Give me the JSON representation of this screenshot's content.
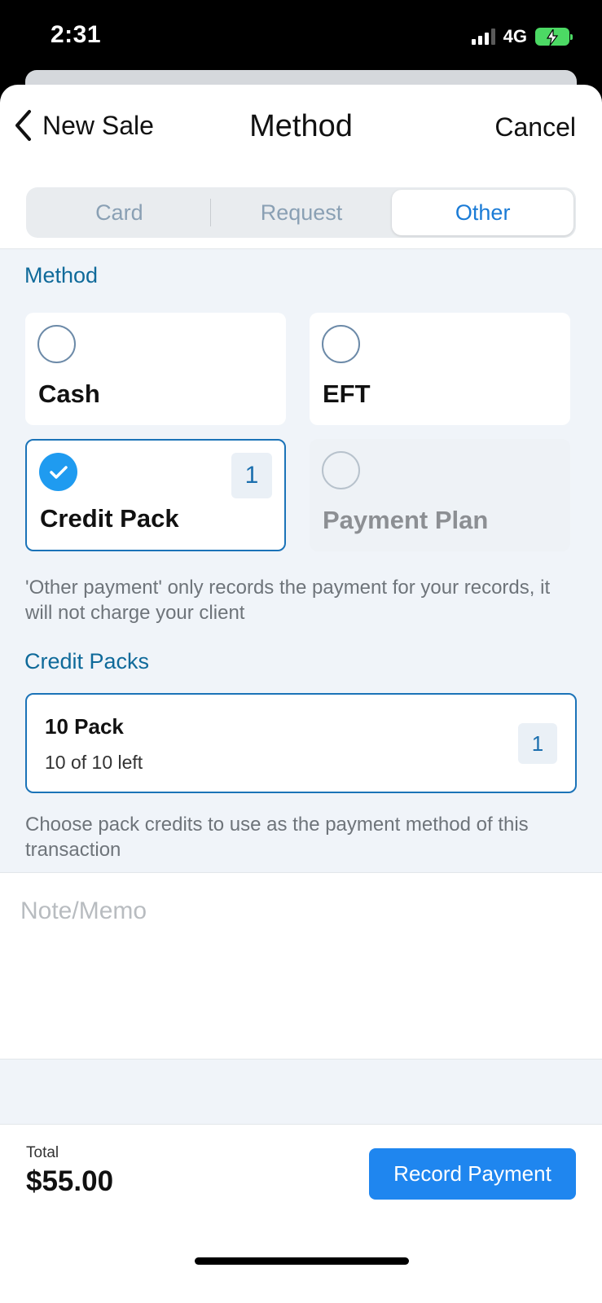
{
  "status_bar": {
    "time": "2:31",
    "network": "4G"
  },
  "nav": {
    "back_label": "New Sale",
    "title": "Method",
    "cancel_label": "Cancel"
  },
  "tabs": [
    {
      "label": "Card",
      "active": false
    },
    {
      "label": "Request",
      "active": false
    },
    {
      "label": "Other",
      "active": true
    }
  ],
  "method_section": {
    "label": "Method",
    "options": [
      {
        "name": "Cash",
        "selected": false,
        "disabled": false
      },
      {
        "name": "EFT",
        "selected": false,
        "disabled": false
      },
      {
        "name": "Credit Pack",
        "selected": true,
        "disabled": false,
        "count": "1"
      },
      {
        "name": "Payment Plan",
        "selected": false,
        "disabled": true
      }
    ],
    "help_text": "'Other payment' only records the payment for your records, it will not charge your client"
  },
  "credit_packs": {
    "label": "Credit Packs",
    "items": [
      {
        "name": "10 Pack",
        "remaining": "10 of 10 left",
        "count": "1"
      }
    ],
    "help_text": "Choose pack credits to use as the payment method of this transaction"
  },
  "memo": {
    "placeholder": "Note/Memo",
    "value": ""
  },
  "footer": {
    "total_label": "Total",
    "total_value": "$55.00",
    "button_label": "Record Payment"
  },
  "colors": {
    "accent": "#1f86ef",
    "section_label": "#0f6a9a",
    "selected_border": "#1b73b8",
    "battery": "#4cd964"
  }
}
